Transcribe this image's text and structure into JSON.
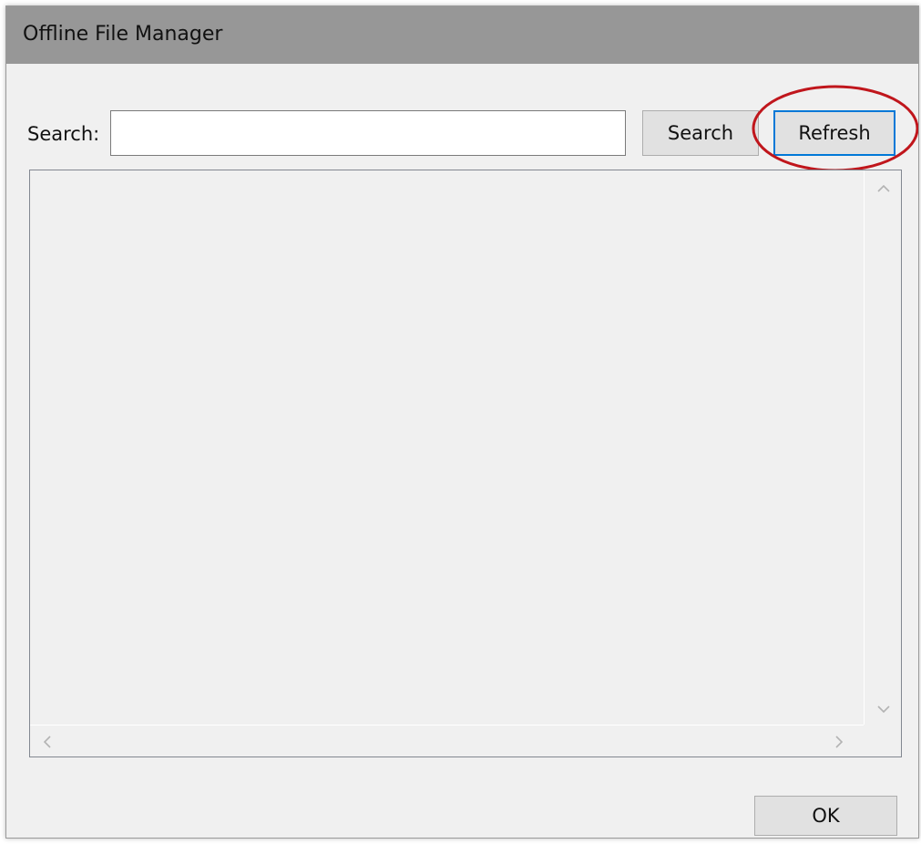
{
  "window": {
    "title": "Offline File Manager"
  },
  "search": {
    "label": "Search:",
    "value": "",
    "placeholder": "",
    "search_button_label": "Search",
    "refresh_button_label": "Refresh"
  },
  "list": {
    "items": []
  },
  "footer": {
    "ok_label": "OK"
  },
  "colors": {
    "titlebar": "#979797",
    "dialog_bg": "#f0f0f0",
    "focus_border": "#0078d7",
    "annotation": "#c0161c"
  }
}
